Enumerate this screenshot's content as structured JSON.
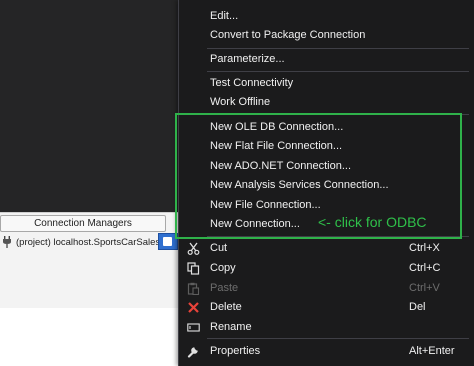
{
  "connection_managers": {
    "tab_label": "Connection Managers",
    "item_label": "(project) localhost.SportsCarSales"
  },
  "menu": {
    "items": [
      {
        "label": "Edit...",
        "shortcut": ""
      },
      {
        "label": "Convert to Package Connection",
        "shortcut": ""
      },
      {
        "label": "Parameterize...",
        "shortcut": ""
      },
      {
        "label": "Test Connectivity",
        "shortcut": ""
      },
      {
        "label": "Work Offline",
        "shortcut": ""
      },
      {
        "label": "New OLE DB Connection...",
        "shortcut": ""
      },
      {
        "label": "New Flat File Connection...",
        "shortcut": ""
      },
      {
        "label": "New ADO.NET Connection...",
        "shortcut": ""
      },
      {
        "label": "New Analysis Services Connection...",
        "shortcut": ""
      },
      {
        "label": "New File Connection...",
        "shortcut": ""
      },
      {
        "label": "New Connection...",
        "shortcut": ""
      },
      {
        "label": "Cut",
        "shortcut": "Ctrl+X",
        "icon": "scissors-icon"
      },
      {
        "label": "Copy",
        "shortcut": "Ctrl+C",
        "icon": "copy-icon"
      },
      {
        "label": "Paste",
        "shortcut": "Ctrl+V",
        "icon": "paste-icon",
        "disabled": true
      },
      {
        "label": "Delete",
        "shortcut": "Del",
        "icon": "delete-x-icon"
      },
      {
        "label": "Rename",
        "shortcut": "",
        "icon": "rename-icon"
      },
      {
        "label": "Properties",
        "shortcut": "Alt+Enter",
        "icon": "wrench-icon"
      }
    ]
  },
  "annotation": {
    "text": "<- click for ODBC",
    "color": "#2fc04a"
  },
  "colors": {
    "menu_background": "#1b1b1c",
    "menu_text": "#f1f1f1",
    "highlight": "#2fb24a",
    "delete_icon": "#e8433a"
  }
}
